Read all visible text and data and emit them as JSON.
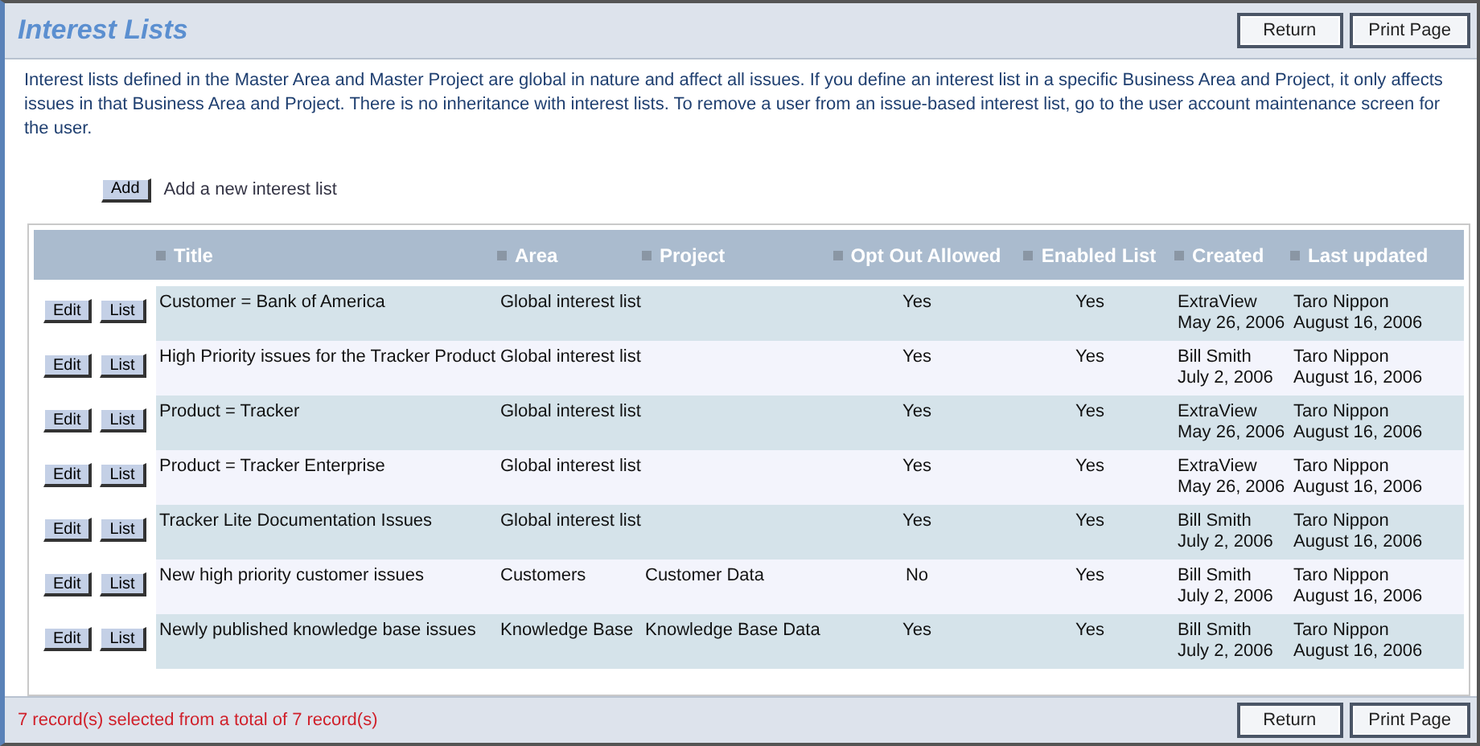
{
  "header": {
    "title": "Interest Lists",
    "buttons": [
      "Return",
      "Print Page"
    ]
  },
  "description": "Interest lists defined in the Master Area and Master Project are global in nature and affect all issues. If you define an interest list in a specific Business Area and Project, it only affects issues in that Business Area and Project. There is no inheritance with interest lists. To remove a user from an issue-based interest list, go to the user account maintenance screen for the user.",
  "add": {
    "button": "Add",
    "label": "Add a new interest list"
  },
  "table": {
    "columns": [
      "Title",
      "Area",
      "Project",
      "Opt Out Allowed",
      "Enabled List",
      "Created",
      "Last updated"
    ],
    "rows": [
      {
        "actions": [
          "Edit",
          "List"
        ],
        "title": "Customer = Bank of America",
        "area": "Global interest list",
        "project": "",
        "opt_out": "Yes",
        "enabled": "Yes",
        "created": [
          "ExtraView",
          "May 26, 2006"
        ],
        "updated": [
          "Taro Nippon",
          "August 16, 2006"
        ]
      },
      {
        "actions": [
          "Edit",
          "List"
        ],
        "title": "High Priority issues for the Tracker Product",
        "area": "Global interest list",
        "project": "",
        "opt_out": "Yes",
        "enabled": "Yes",
        "created": [
          "Bill Smith",
          "July 2, 2006"
        ],
        "updated": [
          "Taro Nippon",
          "August 16, 2006"
        ]
      },
      {
        "actions": [
          "Edit",
          "List"
        ],
        "title": "Product = Tracker",
        "area": "Global interest list",
        "project": "",
        "opt_out": "Yes",
        "enabled": "Yes",
        "created": [
          "ExtraView",
          "May 26, 2006"
        ],
        "updated": [
          "Taro Nippon",
          "August 16, 2006"
        ]
      },
      {
        "actions": [
          "Edit",
          "List"
        ],
        "title": "Product = Tracker Enterprise",
        "area": "Global interest list",
        "project": "",
        "opt_out": "Yes",
        "enabled": "Yes",
        "created": [
          "ExtraView",
          "May 26, 2006"
        ],
        "updated": [
          "Taro Nippon",
          "August 16, 2006"
        ]
      },
      {
        "actions": [
          "Edit",
          "List"
        ],
        "title": "Tracker Lite Documentation Issues",
        "area": "Global interest list",
        "project": "",
        "opt_out": "Yes",
        "enabled": "Yes",
        "created": [
          "Bill Smith",
          "July 2, 2006"
        ],
        "updated": [
          "Taro Nippon",
          "August 16, 2006"
        ]
      },
      {
        "actions": [
          "Edit",
          "List"
        ],
        "title": "New high priority customer issues",
        "area": "Customers",
        "project": "Customer Data",
        "opt_out": "No",
        "enabled": "Yes",
        "created": [
          "Bill Smith",
          "July 2, 2006"
        ],
        "updated": [
          "Taro Nippon",
          "August 16, 2006"
        ]
      },
      {
        "actions": [
          "Edit",
          "List"
        ],
        "title": "Newly published knowledge base issues",
        "area": "Knowledge Base",
        "project": "Knowledge Base Data",
        "opt_out": "Yes",
        "enabled": "Yes",
        "created": [
          "Bill Smith",
          "July 2, 2006"
        ],
        "updated": [
          "Taro Nippon",
          "August 16, 2006"
        ]
      }
    ]
  },
  "footer": {
    "status": "7 record(s) selected from a total of 7 record(s)",
    "buttons": [
      "Return",
      "Print Page"
    ]
  }
}
